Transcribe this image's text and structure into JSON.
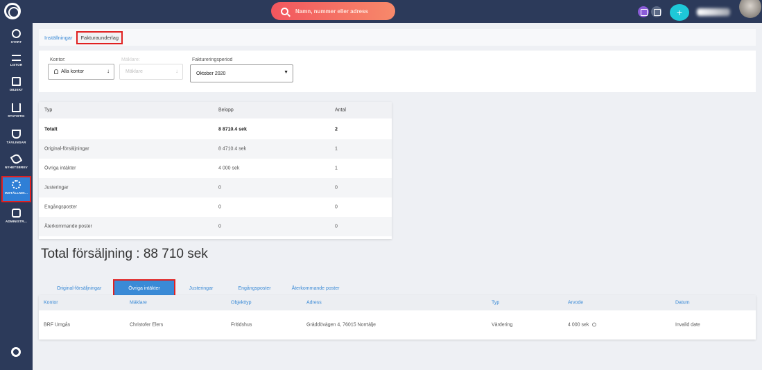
{
  "topbar": {
    "search_placeholder": "Namn, nummer eller adress",
    "plus_label": "+"
  },
  "sidebar": {
    "items": [
      {
        "label": "START",
        "icon": "gauge-icon"
      },
      {
        "label": "LISTOR",
        "icon": "list-icon"
      },
      {
        "label": "OBJEKT",
        "icon": "home-icon"
      },
      {
        "label": "STATISTIK",
        "icon": "bar-chart-icon"
      },
      {
        "label": "TÄVLINGAR",
        "icon": "trophy-icon"
      },
      {
        "label": "NYHETSBREV",
        "icon": "send-icon"
      },
      {
        "label": "INSTÄLLNIN...",
        "icon": "gear-icon",
        "active": true
      },
      {
        "label": "ADMINISTR...",
        "icon": "lock-icon"
      }
    ]
  },
  "breadcrumb": {
    "parent": "Inställningar",
    "current": "Fakturaunderlag"
  },
  "filters": {
    "office_label": "Kontor:",
    "office_value": "Alla kontor",
    "broker_label": "Mäklare:",
    "broker_value": "Mäklare",
    "period_label": "Faktureringsperiod",
    "period_value": "Oktober 2020"
  },
  "summary": {
    "headers": [
      "Typ",
      "Belopp",
      "Antal"
    ],
    "total": {
      "type": "Totalt",
      "amount": "8 8710.4 sek",
      "count": "2"
    },
    "rows": [
      {
        "type": "Original-försäljningar",
        "amount": "8 4710.4 sek",
        "count": "1"
      },
      {
        "type": "Övriga intäkter",
        "amount": "4 000 sek",
        "count": "1"
      },
      {
        "type": "Justeringar",
        "amount": "0",
        "count": "0"
      },
      {
        "type": "Engångsposter",
        "amount": "0",
        "count": "0"
      },
      {
        "type": "Återkommande poster",
        "amount": "0",
        "count": "0"
      }
    ]
  },
  "total_sales": "Total försäljning : 88 710 sek",
  "tabs": [
    {
      "label": "Original-försäljningar"
    },
    {
      "label": "Övriga intäkter",
      "active": true
    },
    {
      "label": "Justeringar"
    },
    {
      "label": "Engångsposter"
    },
    {
      "label": "Återkommande poster"
    }
  ],
  "detail": {
    "headers": [
      "Kontor",
      "Mäklare",
      "Objekttyp",
      "Adress",
      "Typ",
      "Arvode",
      "Datum"
    ],
    "rows": [
      {
        "office": "BRF Umgås",
        "broker": "Christofer Elers",
        "object_type": "Fritidshus",
        "address": "Gräddövägen 4, 76015 Norrtälje",
        "type": "Värdering",
        "fee": "4 000 sek",
        "date": "Invalid date"
      }
    ]
  },
  "colors": {
    "nav_bg": "#2c3a5a",
    "accent": "#3a8ad6",
    "highlight_border": "#e02020",
    "search_gradient": [
      "#f2565e",
      "#f7896a"
    ],
    "plus_button": "#1ec8d8"
  }
}
